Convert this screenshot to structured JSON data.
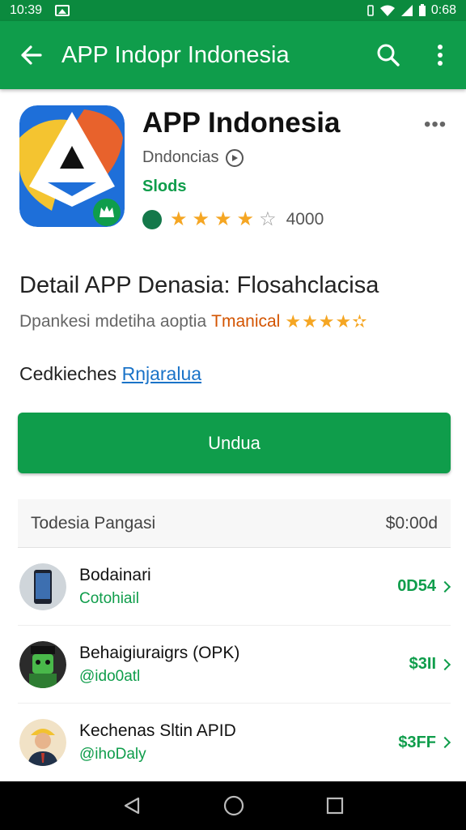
{
  "status_bar": {
    "time": "10:39",
    "clock_right": "0:68"
  },
  "app_bar": {
    "title": "APP Indopr Indonesia"
  },
  "app": {
    "name": "APP Indonesia",
    "developer": "Dndoncias",
    "category": "Slods",
    "rating_stars": 3.5,
    "rating_count": "4000"
  },
  "detail": {
    "title": "Detail APP Denasia: Flosahclacisa",
    "subtitle": "Dpankesi mdetiha aoptia",
    "tag": "Tmanical",
    "tag_stars": "★★★★✫"
  },
  "checks": {
    "label": "Cedkieches",
    "link": "Rnjaralua"
  },
  "install_button": {
    "label": "Undua"
  },
  "list": {
    "header_label": "Todesia Pangasi",
    "header_price": "$0:00d",
    "items": [
      {
        "title": "Bodainari",
        "subtitle": "Cotohiail",
        "price": "0D54"
      },
      {
        "title": "Behaigiuraigrs (OPK)",
        "subtitle": "@ido0atl",
        "price": "$3II"
      },
      {
        "title": "Kechenas Sltin APID",
        "subtitle": "@ihoDaly",
        "price": "$3FF"
      }
    ]
  },
  "colors": {
    "primary": "#0f9d4b",
    "status": "#0b8a3e",
    "star": "#f5a623",
    "link": "#1a73c8"
  }
}
